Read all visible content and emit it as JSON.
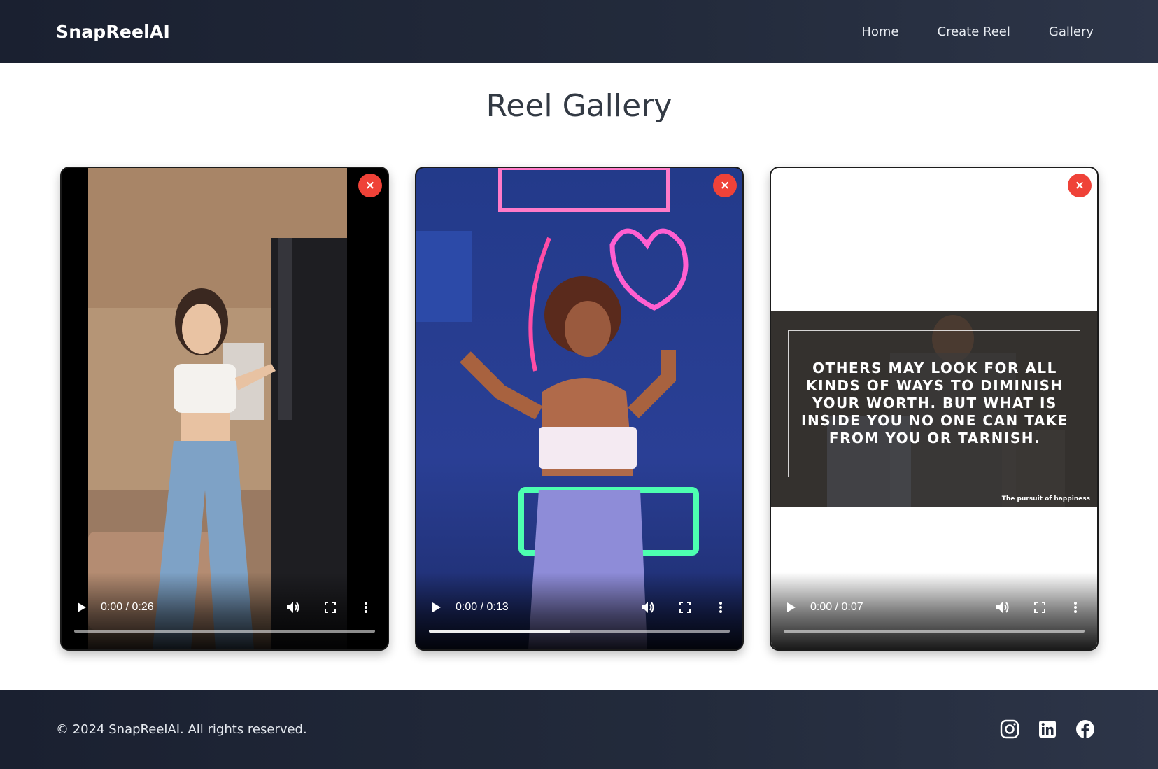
{
  "nav": {
    "brand": "SnapReelAI",
    "links": [
      "Home",
      "Create Reel",
      "Gallery"
    ]
  },
  "page": {
    "title": "Reel Gallery"
  },
  "reels": [
    {
      "time": "0:00 / 0:26",
      "close_label": "×",
      "progress": 0.0
    },
    {
      "time": "0:00 / 0:13",
      "close_label": "×",
      "progress": 0.0,
      "buffered": 0.47
    },
    {
      "time": "0:00 / 0:07",
      "close_label": "×",
      "progress": 0.0,
      "quote": "OTHERS MAY LOOK FOR ALL KINDS OF WAYS TO DIMINISH YOUR WORTH. BUT WHAT IS INSIDE YOU NO ONE CAN TAKE FROM YOU OR TARNISH.",
      "caption": "The pursuit of happiness"
    }
  ],
  "footer": {
    "copyright": "© 2024 SnapReelAI. All rights reserved.",
    "social": [
      "instagram-icon",
      "linkedin-icon",
      "facebook-icon"
    ]
  },
  "colors": {
    "close_button": "#ef4238",
    "nav_bg": "#1a2030"
  }
}
